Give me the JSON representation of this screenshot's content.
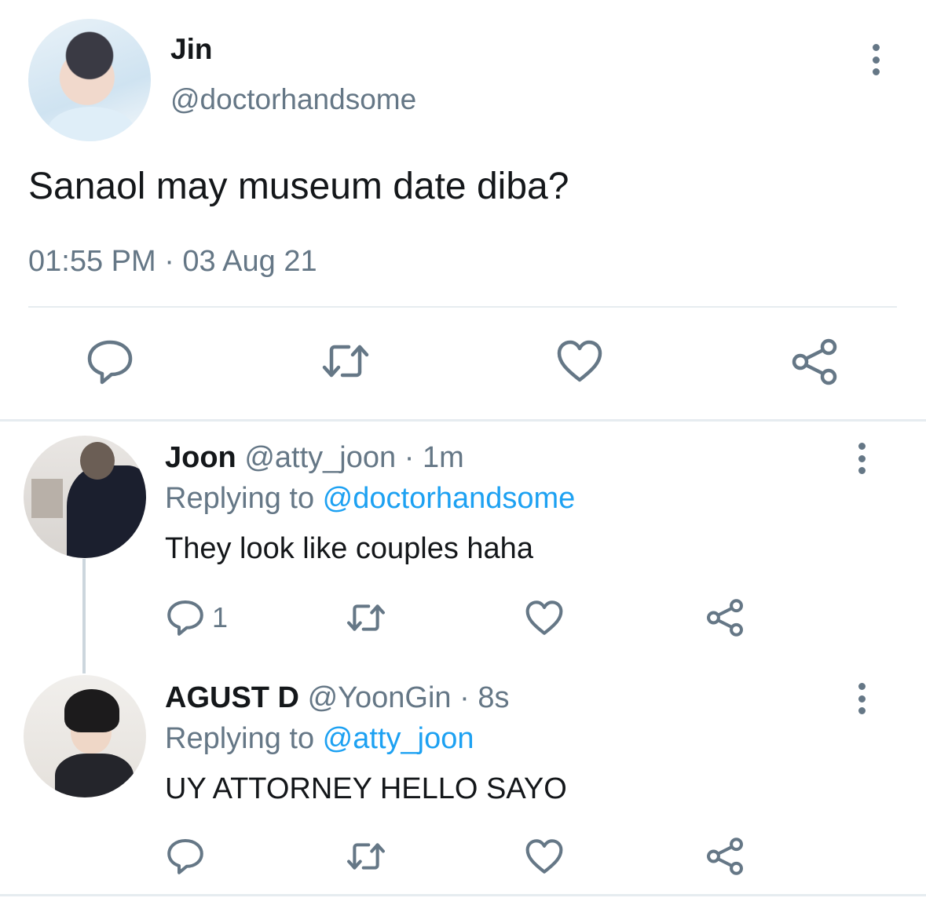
{
  "main_tweet": {
    "name": "Jin",
    "handle": "@doctorhandsome",
    "text": "Sanaol may museum date diba?",
    "timestamp": "01:55 PM · 03 Aug 21",
    "icons": [
      "reply-icon",
      "retweet-icon",
      "like-icon",
      "share-icon"
    ]
  },
  "replies": [
    {
      "name": "Joon",
      "handle": "@atty_joon",
      "separator": " · ",
      "time": "1m",
      "replying_prefix": "Replying to ",
      "replying_to": "@doctorhandsome",
      "text": "They look like couples haha",
      "reply_count": "1"
    },
    {
      "name": "AGUST D",
      "handle": "@YoonGin",
      "separator": " · ",
      "time": "8s",
      "replying_prefix": "Replying to ",
      "replying_to": "@atty_joon",
      "text": "UY ATTORNEY HELLO SAYO",
      "reply_count": ""
    }
  ],
  "colors": {
    "text_primary": "#14171a",
    "text_secondary": "#657786",
    "mention": "#1da1f2",
    "divider": "#e6ecf0"
  }
}
